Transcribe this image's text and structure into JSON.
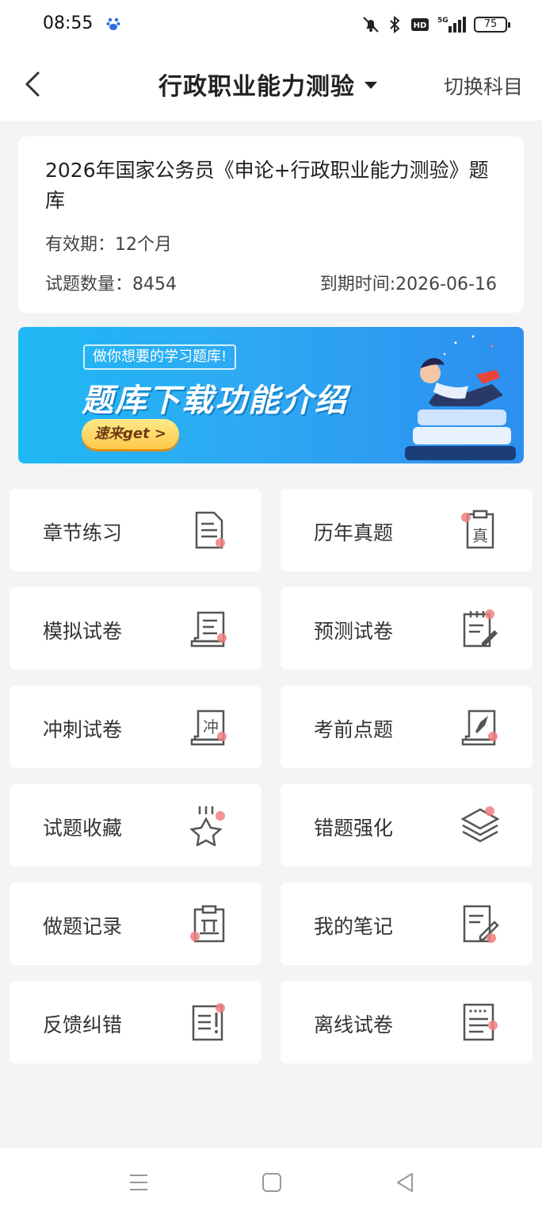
{
  "status": {
    "time": "08:55",
    "battery": "75",
    "network": "5G"
  },
  "header": {
    "title": "行政职业能力测验",
    "switch_label": "切换科目"
  },
  "info": {
    "title": "2026年国家公务员《申论+行政职业能力测验》题库",
    "validity": "有效期：12个月",
    "count": "试题数量：8454",
    "expire": "到期时间:2026-06-16"
  },
  "banner": {
    "tag": "做你想要的学习题库!",
    "main": "题库下载功能介绍",
    "cta": "速来get >"
  },
  "tiles": [
    {
      "label": "章节练习",
      "icon": "document-icon"
    },
    {
      "label": "历年真题",
      "icon": "exam-paper-icon"
    },
    {
      "label": "模拟试卷",
      "icon": "scroll-icon"
    },
    {
      "label": "预测试卷",
      "icon": "clipboard-edit-icon"
    },
    {
      "label": "冲刺试卷",
      "icon": "sprint-scroll-icon"
    },
    {
      "label": "考前点题",
      "icon": "rocket-board-icon"
    },
    {
      "label": "试题收藏",
      "icon": "star-icon"
    },
    {
      "label": "错题强化",
      "icon": "layers-icon"
    },
    {
      "label": "做题记录",
      "icon": "record-clipboard-icon"
    },
    {
      "label": "我的笔记",
      "icon": "note-pen-icon"
    },
    {
      "label": "反馈纠错",
      "icon": "feedback-icon"
    },
    {
      "label": "离线试卷",
      "icon": "offline-paper-icon"
    }
  ],
  "colors": {
    "accent_dot": "#f07f7f",
    "icon_stroke": "#555555",
    "banner_start": "#1fb8f4",
    "banner_end": "#2c8ff0"
  }
}
